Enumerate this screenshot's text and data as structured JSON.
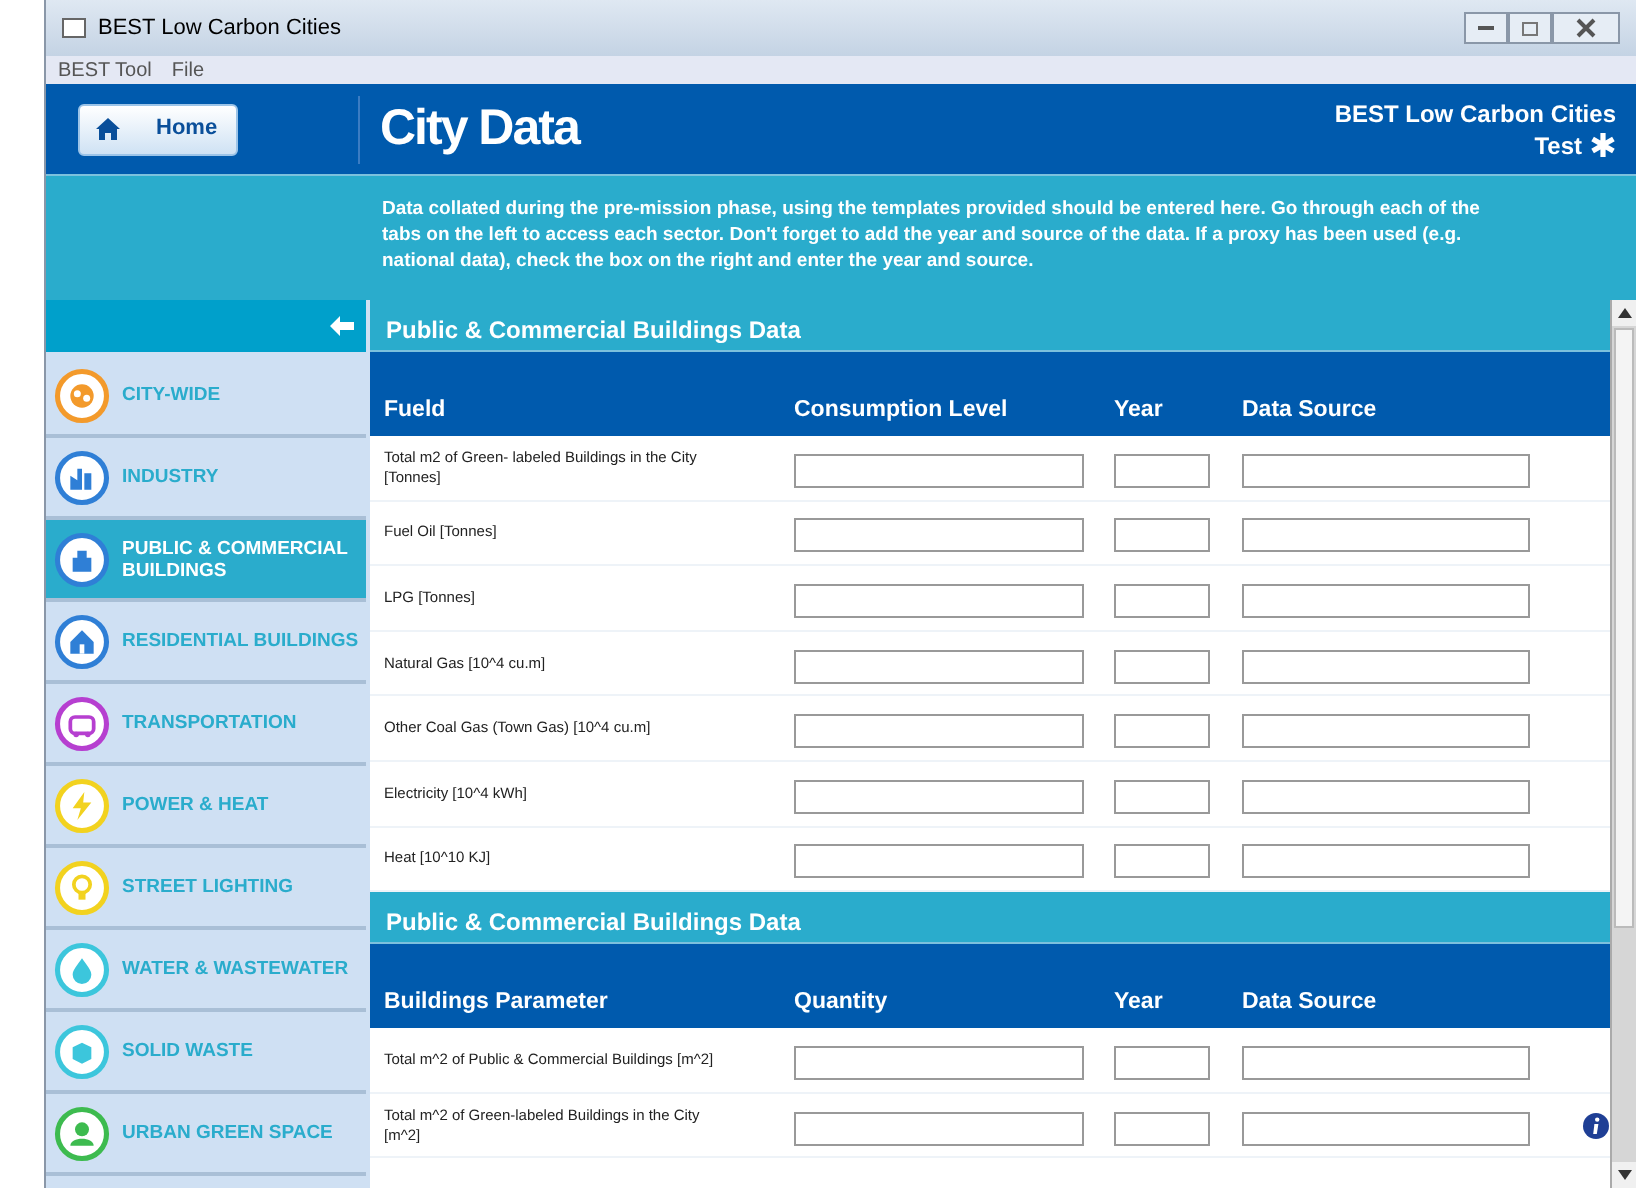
{
  "window": {
    "title": "BEST Low Carbon Cities"
  },
  "menu": [
    "BEST Tool",
    "File"
  ],
  "header": {
    "home_button": "Home",
    "title": "City Data",
    "app_name": "BEST Low Carbon Cities",
    "user": "Test"
  },
  "intro": "Data collated during the pre-mission phase, using the templates provided should be entered here. Go through each of the tabs on the left to access each sector. Don't forget to add the year and source of the data. If a proxy has been used (e.g. national data), check the box on the right and enter the year and source.",
  "sidebar": {
    "items": [
      {
        "label": "CITY-WIDE",
        "color": "#f39a2b",
        "selected": false
      },
      {
        "label": "INDUSTRY",
        "color": "#2f7fd6",
        "selected": false
      },
      {
        "label": "PUBLIC & COMMERCIAL BUILDINGS",
        "color": "#2f7fd6",
        "selected": true
      },
      {
        "label": "RESIDENTIAL BUILDINGS",
        "color": "#2f7fd6",
        "selected": false
      },
      {
        "label": "TRANSPORTATION",
        "color": "#b63fd0",
        "selected": false
      },
      {
        "label": "POWER & HEAT",
        "color": "#f2d21f",
        "selected": false
      },
      {
        "label": "STREET LIGHTING",
        "color": "#f2d21f",
        "selected": false
      },
      {
        "label": "WATER & WASTEWATER",
        "color": "#3cc6dc",
        "selected": false
      },
      {
        "label": "SOLID WASTE",
        "color": "#3cc6dc",
        "selected": false
      },
      {
        "label": "URBAN GREEN SPACE",
        "color": "#3dbb4f",
        "selected": false
      }
    ]
  },
  "sections": [
    {
      "title": "Public & Commercial Buildings Data",
      "columns": [
        "Fueld",
        "Consumption Level",
        "Year",
        "Data Source"
      ],
      "rows": [
        {
          "label": "Total m2 of Green- labeled Buildings in the City [Tonnes]",
          "info": false
        },
        {
          "label": "Fuel Oil [Tonnes]",
          "info": false
        },
        {
          "label": "LPG [Tonnes]",
          "info": false
        },
        {
          "label": "Natural Gas [10^4 cu.m]",
          "info": false
        },
        {
          "label": "Other Coal Gas (Town Gas) [10^4 cu.m]",
          "info": false
        },
        {
          "label": "Electricity [10^4 kWh]",
          "info": false
        },
        {
          "label": "Heat [10^10 KJ]",
          "info": false
        }
      ]
    },
    {
      "title": "Public & Commercial Buildings Data",
      "columns": [
        "Buildings Parameter",
        "Quantity",
        "Year",
        "Data Source"
      ],
      "rows": [
        {
          "label": "Total m^2 of Public & Commercial Buildings [m^2]",
          "info": false
        },
        {
          "label": "Total m^2 of Green-labeled Buildings in the City [m^2]",
          "info": true
        }
      ]
    }
  ]
}
